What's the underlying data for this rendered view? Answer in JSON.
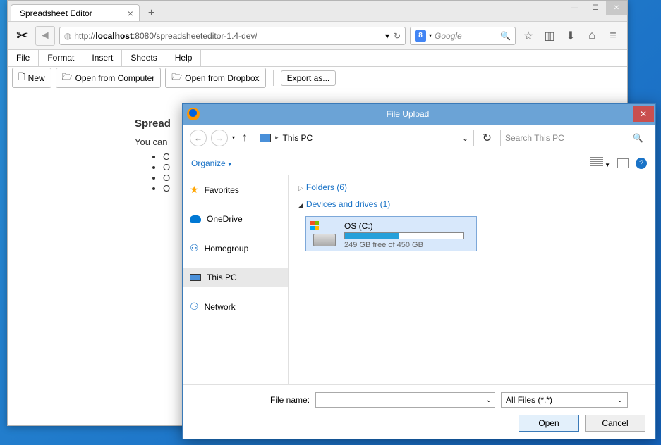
{
  "browser": {
    "tab_title": "Spreadsheet Editor",
    "url_prefix": "http://",
    "url_host": "localhost",
    "url_rest": ":8080/spreadsheeteditor-1.4-dev/",
    "search_placeholder": "Google"
  },
  "app_menu": [
    "File",
    "Format",
    "Insert",
    "Sheets",
    "Help"
  ],
  "app_toolbar": {
    "new": "New",
    "open_computer": "Open from Computer",
    "open_dropbox": "Open from Dropbox",
    "export": "Export as..."
  },
  "content": {
    "heading": "Spread",
    "intro": "You can ",
    "bullets": [
      "C",
      "O",
      "O",
      "O"
    ]
  },
  "dialog": {
    "title": "File Upload",
    "crumb": "This PC",
    "search_placeholder": "Search This PC",
    "organize": "Organize",
    "nav_items": [
      {
        "label": "Favorites",
        "icon": "star"
      },
      {
        "label": "OneDrive",
        "icon": "cloud"
      },
      {
        "label": "Homegroup",
        "icon": "home"
      },
      {
        "label": "This PC",
        "icon": "pc",
        "selected": true
      },
      {
        "label": "Network",
        "icon": "net"
      }
    ],
    "sections": {
      "folders": "Folders (6)",
      "devices": "Devices and drives (1)"
    },
    "drive": {
      "name": "OS (C:)",
      "free_text": "249 GB free of 450 GB",
      "fill_pct": 45
    },
    "footer": {
      "filename_label": "File name:",
      "filter": "All Files (*.*)",
      "open": "Open",
      "cancel": "Cancel"
    }
  }
}
